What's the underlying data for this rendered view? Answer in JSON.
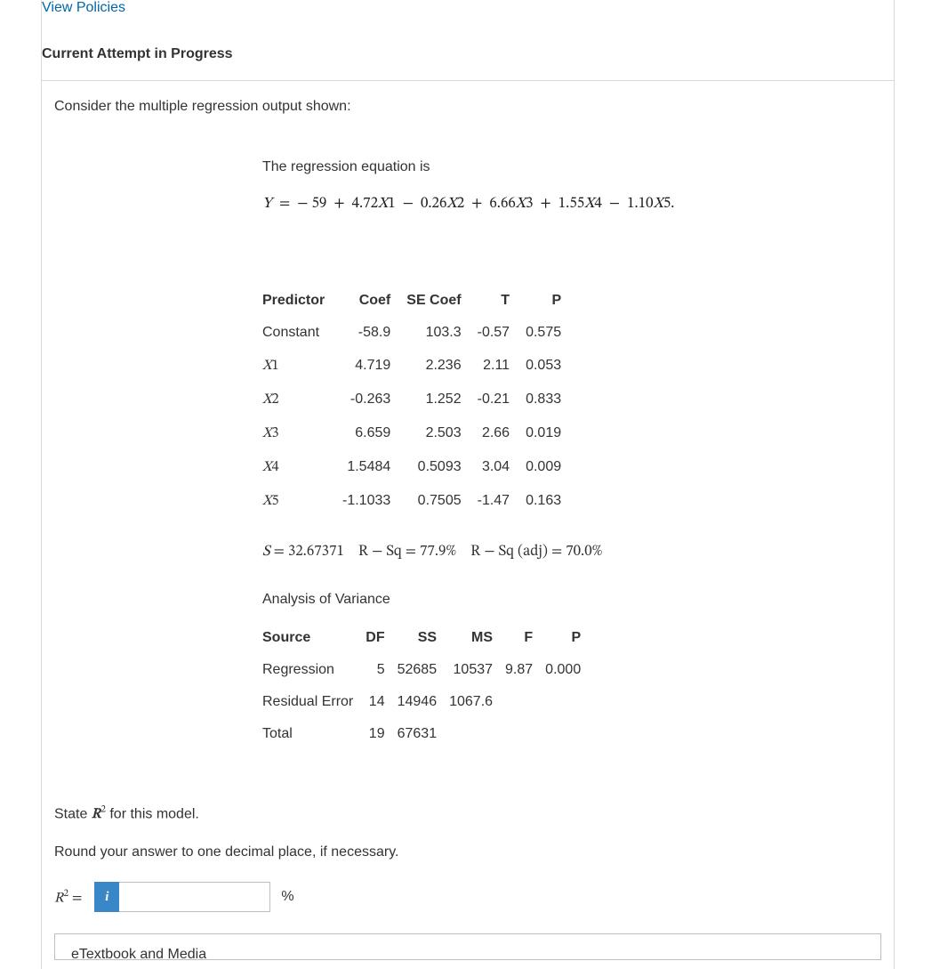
{
  "header": {
    "view_policies": "View Policies",
    "attempt_title": "Current Attempt in Progress"
  },
  "intro": "Consider the multiple regression output shown:",
  "equation_label": "The regression equation is",
  "equation": {
    "lhs_var": "Y",
    "intercept": "− 59",
    "terms": [
      {
        "sign": "+",
        "coef": "4.72",
        "var": "X",
        "sub": "1"
      },
      {
        "sign": "−",
        "coef": "0.26",
        "var": "X",
        "sub": "2"
      },
      {
        "sign": "+",
        "coef": "6.66",
        "var": "X",
        "sub": "3"
      },
      {
        "sign": "+",
        "coef": "1.55",
        "var": "X",
        "sub": "4"
      },
      {
        "sign": "−",
        "coef": "1.10",
        "var": "X",
        "sub": "5"
      }
    ],
    "tail": "."
  },
  "coef_table": {
    "headers": [
      "Predictor",
      "Coef",
      "SE Coef",
      "T",
      "P"
    ],
    "rows": [
      {
        "pred_text": "Constant",
        "pred_math": false,
        "coef": "-58.9",
        "se": "103.3",
        "t": "-0.57",
        "p": "0.575"
      },
      {
        "pred_text": "X1",
        "pred_math": true,
        "coef": "4.719",
        "se": "2.236",
        "t": "2.11",
        "p": "0.053"
      },
      {
        "pred_text": "X2",
        "pred_math": true,
        "coef": "-0.263",
        "se": "1.252",
        "t": "-0.21",
        "p": "0.833"
      },
      {
        "pred_text": "X3",
        "pred_math": true,
        "coef": "6.659",
        "se": "2.503",
        "t": "2.66",
        "p": "0.019"
      },
      {
        "pred_text": "X4",
        "pred_math": true,
        "coef": "1.5484",
        "se": "0.5093",
        "t": "3.04",
        "p": "0.009"
      },
      {
        "pred_text": "X5",
        "pred_math": true,
        "coef": "-1.1033",
        "se": "0.7505",
        "t": "-1.47",
        "p": "0.163"
      }
    ]
  },
  "stats_line": {
    "s_label": "S",
    "s_value": "32.67371",
    "rsq_label": "R − Sq",
    "rsq_value": "77.9%",
    "rsq_adj_label": "R − Sq (adj)",
    "rsq_adj_value": "70.0%"
  },
  "anova": {
    "title": "Analysis of Variance",
    "headers": [
      "Source",
      "DF",
      "SS",
      "MS",
      "F",
      "P"
    ],
    "rows": [
      {
        "source": "Regression",
        "df": "5",
        "ss": "52685",
        "ms": "10537",
        "f": "9.87",
        "p": "0.000"
      },
      {
        "source": "Residual Error",
        "df": "14",
        "ss": "14946",
        "ms": "1067.6",
        "f": "",
        "p": ""
      },
      {
        "source": "Total",
        "df": "19",
        "ss": "67631",
        "ms": "",
        "f": "",
        "p": ""
      }
    ]
  },
  "question": {
    "line1_pre": "State ",
    "line1_math": "R",
    "line1_sup": "2",
    "line1_post": " for this model.",
    "round_text": "Round your answer to one decimal place, if necessary.",
    "answer_label_math": "R",
    "answer_label_sup": "2",
    "answer_eq": " = ",
    "info_badge": "i",
    "percent": "%"
  },
  "media_box": "eTextbook and Media"
}
